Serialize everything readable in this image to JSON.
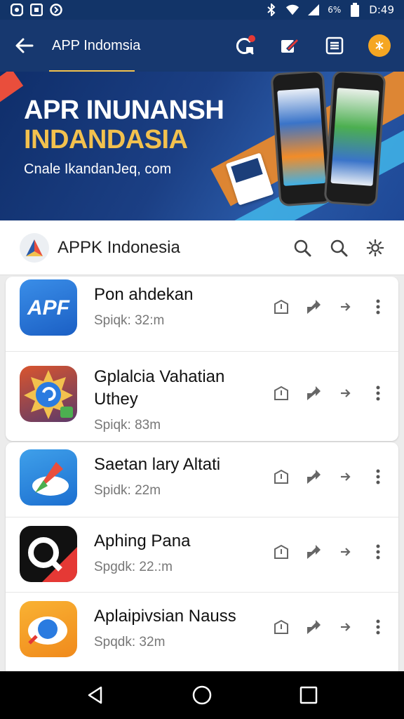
{
  "status_bar": {
    "battery": "6%",
    "time": "D:49"
  },
  "app_bar": {
    "title": "APP Indomsia",
    "has_notification": true
  },
  "banner": {
    "line1": "APR INUNANSH",
    "line2": "INDANDASIA",
    "subtitle": "Cnale IkandanJeq, com"
  },
  "search_header": {
    "brand": "APPK Indonesia"
  },
  "apps_group1": [
    {
      "name": "Pon ahdekan",
      "size": "Spiqk: 32:m",
      "icon": "apf-icon"
    },
    {
      "name": "Gplalcia Vahatian Uthey",
      "size": "Spiqk: 83m",
      "icon": "sun-shield-icon"
    }
  ],
  "apps_group2": [
    {
      "name": "Saetan lary Altati",
      "size": "Spidk: 22m",
      "icon": "rocket-cloud-icon"
    },
    {
      "name": "Aphing Pana",
      "size": "Spgdk: 22.:m",
      "icon": "q-logo-icon"
    },
    {
      "name": "Aplaipivsian Nauss",
      "size": "Spqdk: 32m",
      "icon": "orb-icon"
    }
  ],
  "colors": {
    "appbar": "#17386f",
    "accent": "#f2c14e",
    "coin": "#f5a623"
  }
}
